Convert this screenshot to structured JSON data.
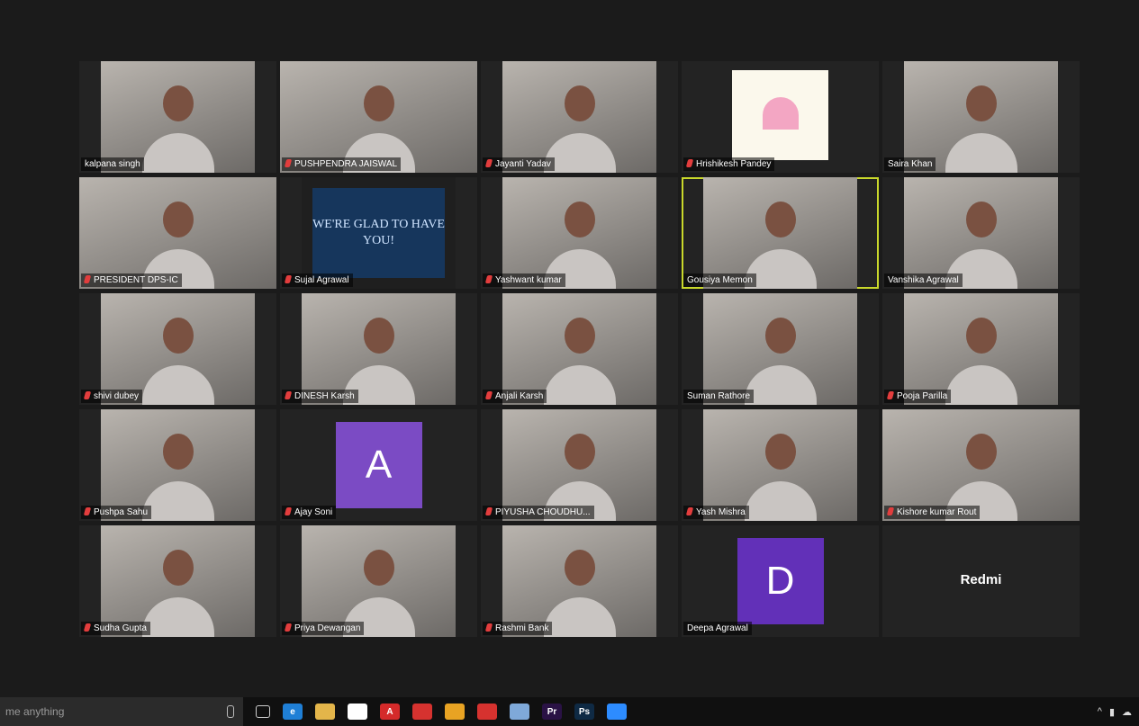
{
  "meeting": {
    "participants": [
      {
        "name": "kalpana singh",
        "muted": false,
        "type": "video"
      },
      {
        "name": "PUSHPENDRA JAISWAL",
        "muted": true,
        "type": "video-wide"
      },
      {
        "name": "Jayanti Yadav",
        "muted": true,
        "type": "video"
      },
      {
        "name": "Hrishikesh Pandey",
        "muted": true,
        "type": "card"
      },
      {
        "name": "Saira Khan",
        "muted": false,
        "type": "video"
      },
      {
        "name": "PRESIDENT DPS-IC",
        "muted": true,
        "type": "video-wide"
      },
      {
        "name": "Sujal Agrawal",
        "muted": true,
        "type": "banner",
        "banner_text": "WE'RE GLAD TO HAVE YOU!"
      },
      {
        "name": "Yashwant kumar",
        "muted": true,
        "type": "video"
      },
      {
        "name": "Gousiya Memon",
        "muted": false,
        "type": "video",
        "active": true
      },
      {
        "name": "Vanshika Agrawal",
        "muted": false,
        "type": "video"
      },
      {
        "name": "shivi dubey",
        "muted": true,
        "type": "video"
      },
      {
        "name": "DINESH Karsh",
        "muted": true,
        "type": "video"
      },
      {
        "name": "Anjali Karsh",
        "muted": true,
        "type": "video"
      },
      {
        "name": "Suman Rathore",
        "muted": false,
        "type": "video"
      },
      {
        "name": "Pooja Parilla",
        "muted": true,
        "type": "video"
      },
      {
        "name": "Pushpa Sahu",
        "muted": true,
        "type": "video"
      },
      {
        "name": "Ajay Soni",
        "muted": true,
        "type": "avatar",
        "initial": "A",
        "color": "#7b4bc4"
      },
      {
        "name": "PIYUSHA CHOUDHU...",
        "muted": true,
        "type": "video"
      },
      {
        "name": "Yash Mishra",
        "muted": true,
        "type": "video"
      },
      {
        "name": "Kishore kumar Rout",
        "muted": true,
        "type": "video-wide"
      },
      {
        "name": "Sudha Gupta",
        "muted": true,
        "type": "video"
      },
      {
        "name": "Priya Dewangan",
        "muted": true,
        "type": "video"
      },
      {
        "name": "Rashmi Bank",
        "muted": true,
        "type": "video"
      },
      {
        "name": "Deepa Agrawal",
        "muted": false,
        "type": "avatar",
        "initial": "D",
        "color": "#6230b8"
      },
      {
        "name": "Redmi",
        "muted": false,
        "type": "device",
        "show_label": false
      }
    ]
  },
  "taskbar": {
    "search_placeholder": "me anything",
    "apps": [
      {
        "icon": "task-view-icon",
        "label": "",
        "color": "#101010"
      },
      {
        "icon": "edge-icon",
        "label": "e",
        "color": "#1f7fd6"
      },
      {
        "icon": "file-explorer-icon",
        "label": "",
        "color": "#e3b54a"
      },
      {
        "icon": "store-icon",
        "label": "",
        "color": "#ffffff"
      },
      {
        "icon": "acrobat-icon",
        "label": "A",
        "color": "#d42a2a"
      },
      {
        "icon": "app-red-icon",
        "label": "",
        "color": "#d6322f"
      },
      {
        "icon": "chrome-icon",
        "label": "",
        "color": "#e8a323"
      },
      {
        "icon": "app-red2-icon",
        "label": "",
        "color": "#d6322f"
      },
      {
        "icon": "app-blue-icon",
        "label": "",
        "color": "#7fa9d9"
      },
      {
        "icon": "premiere-icon",
        "label": "Pr",
        "color": "#2a1245"
      },
      {
        "icon": "photoshop-icon",
        "label": "Ps",
        "color": "#0f2a44"
      },
      {
        "icon": "zoom-icon",
        "label": "",
        "color": "#2d8cff"
      }
    ]
  }
}
